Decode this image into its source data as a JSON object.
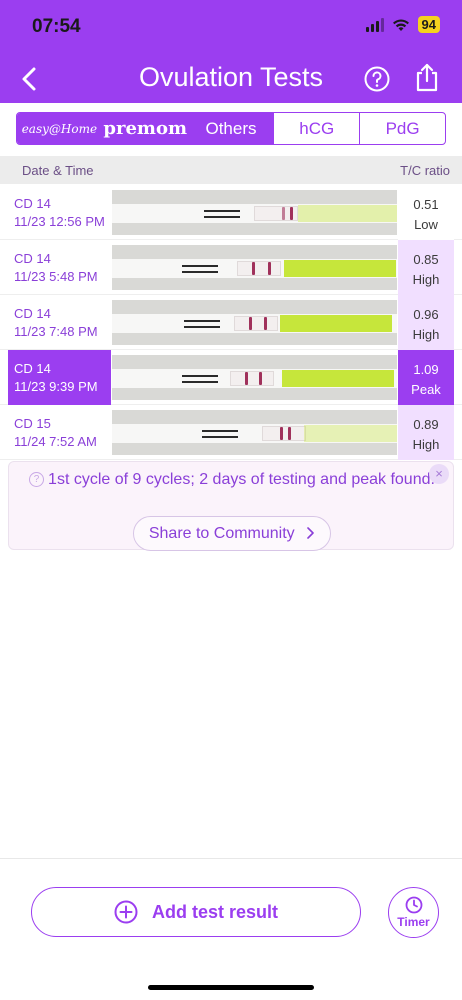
{
  "status_bar": {
    "time": "07:54",
    "battery": "94"
  },
  "header": {
    "title": "Ovulation Tests",
    "back_icon": "chevron-left-icon",
    "help_icon": "question-circle-icon",
    "share_icon": "share-icon"
  },
  "tabs": [
    {
      "label": "easy@Home",
      "active": true
    },
    {
      "label": "premom",
      "active": true
    },
    {
      "label": "Others",
      "active": true
    },
    {
      "label": "hCG",
      "active": false
    },
    {
      "label": "PdG",
      "active": false
    }
  ],
  "columns": {
    "left": "Date & Time",
    "right": "T/C ratio"
  },
  "results": [
    {
      "cd": "CD 14",
      "datetime": "11/23 12:56 PM",
      "ratio": "0.51",
      "level": "Low",
      "selected": false
    },
    {
      "cd": "CD 14",
      "datetime": "11/23 5:48 PM",
      "ratio": "0.85",
      "level": "High",
      "selected": false
    },
    {
      "cd": "CD 14",
      "datetime": "11/23 7:48 PM",
      "ratio": "0.96",
      "level": "High",
      "selected": false
    },
    {
      "cd": "CD 14",
      "datetime": "11/23 9:39 PM",
      "ratio": "1.09",
      "level": "Peak",
      "selected": true
    },
    {
      "cd": "CD 15",
      "datetime": "11/24 7:52 AM",
      "ratio": "0.89",
      "level": "High",
      "selected": false
    }
  ],
  "info": {
    "message": "1st cycle of 9 cycles; 2 days of testing and peak found.",
    "share_label": "Share to Community",
    "close": "×"
  },
  "bottom": {
    "add_label": "Add test result",
    "timer_label": "Timer"
  },
  "colors": {
    "accent": "#9b3ef0",
    "ratio_bg": "#f1dfff"
  }
}
